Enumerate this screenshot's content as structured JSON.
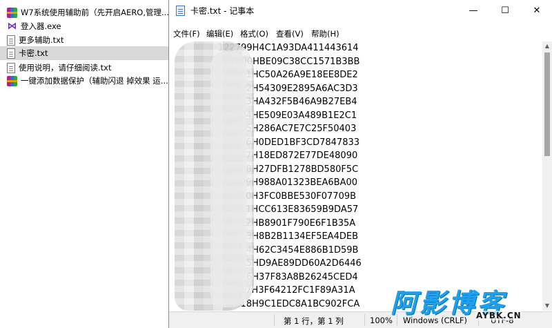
{
  "explorer": {
    "files": [
      {
        "name": "W7系统使用辅助前（先开启AERO,管理...",
        "icon": "winrar-archive-icon",
        "selected": false
      },
      {
        "name": "登入器.exe",
        "icon": "visual-studio-exe-icon",
        "selected": false
      },
      {
        "name": "更多辅助.txt",
        "icon": "text-file-icon",
        "selected": false
      },
      {
        "name": "卡密.txt",
        "icon": "text-file-icon",
        "selected": true
      },
      {
        "name": "使用说明，请仔细阅读.txt",
        "icon": "text-file-icon",
        "selected": false
      },
      {
        "name": "一键添加数据保护（辅助闪退 掉效果 运...",
        "icon": "winrar-archive-icon",
        "selected": false
      }
    ]
  },
  "notepad": {
    "title": "卡密.txt - 记事本",
    "controls": {
      "minimize": "—",
      "maximize": "☐",
      "close": "✕"
    },
    "menu": [
      "文件(F)",
      "编辑(E)",
      "格式(O)",
      "查看(V)",
      "帮助(H)"
    ],
    "lines": [
      "122799H4C1A93DA411443614",
      "2800HBE09C38CC1571B3BB",
      "801HC50A26A9E18EE8DE2",
      "802H54309E2895A6AC3D3",
      "803HA432F5B46A9B27EB4",
      "804HE509E03A489B1E2C1",
      "805H286AC7E7C25F50403",
      "806H0DED1BF3CD7847833",
      "07H18ED872E77DE48090",
      "808H27DFB1278BD580F5C",
      "09H988A01323BEA6BA00",
      "10H3FC0BBE530F07709B",
      "11HCC613E83659B9DA57",
      "12HB8901F790E6F1B35A",
      "3H8B2B1134EF5EA4DEB",
      "4H62C3454E886B1D59B",
      "5HD9AE89DD60A2D6446",
      "6H37F83A8B26245CED4",
      "17H3F64212FC1F89A31A",
      "2818H9C1EDC8A1BC902FCA"
    ],
    "status": {
      "position": "第 1 行，第 1 列",
      "zoom": "100%",
      "encoding_line": "Windows (CRLF)",
      "charset": "UTF-8"
    }
  },
  "watermark": {
    "main": "阿影博客",
    "sub": "AYBK.CN",
    "color": "#1da0ee"
  }
}
